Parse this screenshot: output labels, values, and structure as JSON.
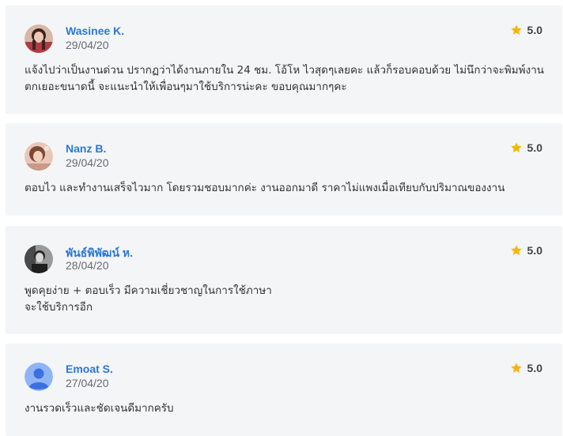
{
  "reviews": [
    {
      "name": "Wasinee K.",
      "date": "29/04/20",
      "rating": "5.0",
      "lines": [
        "แจ้งไปว่าเป็นงานด่วน ปรากฏว่าได้งานภายใน 24 ชม. โอ้โห ไวสุดๆเลยคะ แล้วก็รอบคอบด้วย ไม่นึกว่าจะพิมพ์งาน",
        "ตกเยอะขนาดนี้ จะแนะนำให้เพื่อนๆมาใช้บริการน่ะคะ ขอบคุณมากๆคะ"
      ],
      "avatar": "photo-woman-1"
    },
    {
      "name": "Nanz B.",
      "date": "29/04/20",
      "rating": "5.0",
      "lines": [
        "ตอบไว และทำงานเสร็จไวมาก โดยรวมชอบมากค่ะ งานออกมาดี ราคาไม่แพงเมื่อเทียบกับปริมาณของงาน"
      ],
      "avatar": "photo-woman-2"
    },
    {
      "name": "พันธ์พิพัฒน์ ห.",
      "date": "28/04/20",
      "rating": "5.0",
      "lines": [
        "พูดคุยง่าย + ตอบเร็ว มีความเชี่ยวชาญในการใช้ภาษา",
        "จะใช้บริการอีก"
      ],
      "avatar": "photo-man-bw"
    },
    {
      "name": "Emoat S.",
      "date": "27/04/20",
      "rating": "5.0",
      "lines": [
        "งานรวดเร็วและชัดเจนดีมากครับ"
      ],
      "avatar": "default-user-avatar"
    }
  ],
  "colors": {
    "name": "#2a78d6",
    "star": "#f5b50a",
    "card_bg": "#f4f5f7"
  }
}
